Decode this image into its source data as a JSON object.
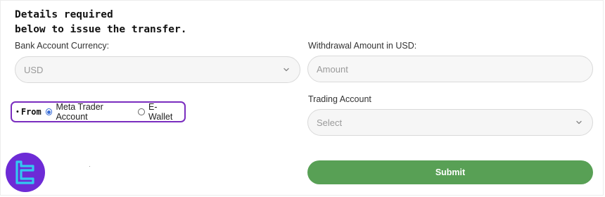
{
  "form": {
    "heading": "Details required\nbelow to issue the transfer.",
    "currency": {
      "label": "Bank Account Currency:",
      "value": "USD"
    },
    "withdrawal": {
      "label": "Withdrawal Amount in USD:",
      "placeholder": "Amount"
    },
    "trading": {
      "label": "Trading Account",
      "value": "Select"
    },
    "from": {
      "bullet": "•",
      "label": "From",
      "options": [
        {
          "label": "Meta Trader Account",
          "checked": true
        },
        {
          "label": "E-Wallet",
          "checked": false
        }
      ]
    },
    "submit_label": "Submit"
  },
  "colors": {
    "highlight_border": "#7a2dbf",
    "submit_bg": "#58a055",
    "radio_checked": "#3a6ed8",
    "logo_bg": "#6d2bd6",
    "logo_mark": "#33c8f0"
  },
  "icons": {
    "select_chevron": "chevron-down-icon",
    "logo": "tradingfinder-logo"
  }
}
